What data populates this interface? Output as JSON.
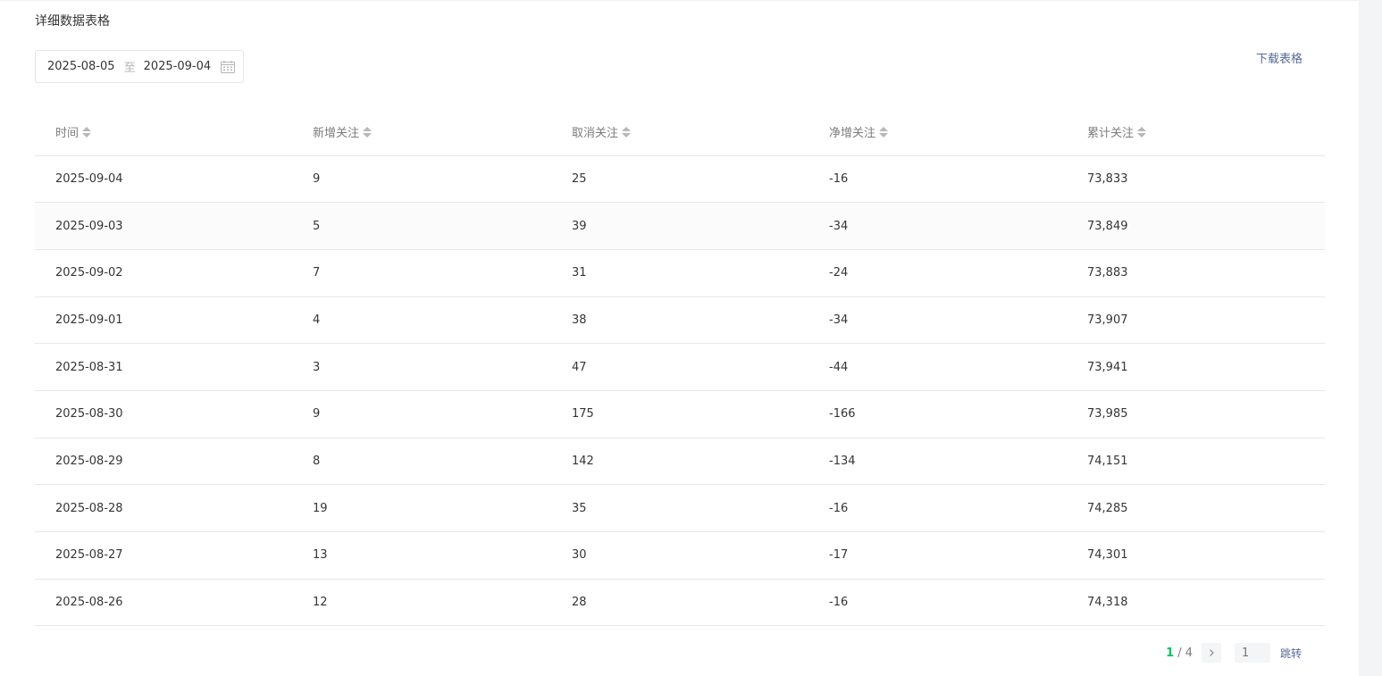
{
  "section": {
    "title": "详细数据表格"
  },
  "date_range": {
    "start": "2025-08-05",
    "separator": "至",
    "end": "2025-09-04"
  },
  "download_label": "下载表格",
  "table": {
    "headers": [
      "时间",
      "新增关注",
      "取消关注",
      "净增关注",
      "累计关注"
    ],
    "rows": [
      [
        "2025-09-04",
        "9",
        "25",
        "-16",
        "73,833"
      ],
      [
        "2025-09-03",
        "5",
        "39",
        "-34",
        "73,849"
      ],
      [
        "2025-09-02",
        "7",
        "31",
        "-24",
        "73,883"
      ],
      [
        "2025-09-01",
        "4",
        "38",
        "-34",
        "73,907"
      ],
      [
        "2025-08-31",
        "3",
        "47",
        "-44",
        "73,941"
      ],
      [
        "2025-08-30",
        "9",
        "175",
        "-166",
        "73,985"
      ],
      [
        "2025-08-29",
        "8",
        "142",
        "-134",
        "74,151"
      ],
      [
        "2025-08-28",
        "19",
        "35",
        "-16",
        "74,285"
      ],
      [
        "2025-08-27",
        "13",
        "30",
        "-17",
        "74,301"
      ],
      [
        "2025-08-26",
        "12",
        "28",
        "-16",
        "74,318"
      ]
    ]
  },
  "pagination": {
    "current": "1",
    "total_text": "/ 4",
    "input_placeholder": "1",
    "jump_label": "跳转"
  },
  "colors": {
    "accent_green": "#07c160",
    "link_blue": "#576b95"
  }
}
